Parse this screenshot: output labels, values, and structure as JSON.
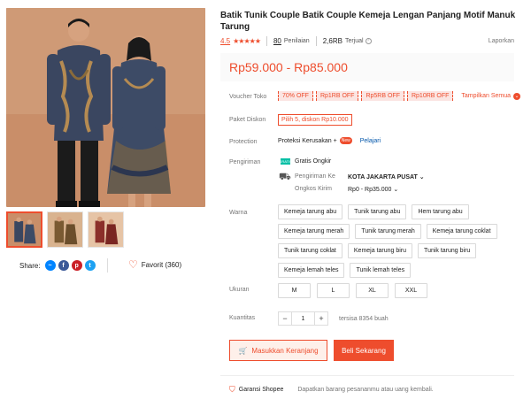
{
  "product": {
    "title": "Batik Tunik Couple Batik Couple Kemeja Lengan Panjang Motif Manuk Tarung",
    "rating": "4.5",
    "reviews_count": "80",
    "reviews_label": "Penilaian",
    "sold_count": "2,6RB",
    "sold_label": "Terjual",
    "report_label": "Laporkan",
    "price_range": "Rp59.000 - Rp85.000"
  },
  "voucher": {
    "label": "Voucher Toko",
    "items": [
      "70% OFF",
      "Rp1RB OFF",
      "Rp5RB OFF",
      "Rp10RB OFF"
    ],
    "show_all": "Tampilkan Semua"
  },
  "paket": {
    "label": "Paket Diskon",
    "value": "Pilih 5, diskon Rp10.000"
  },
  "protection": {
    "label": "Protection",
    "value": "Proteksi Kerusakan +",
    "badge": "New",
    "link": "Pelajari"
  },
  "shipping": {
    "label": "Pengiriman",
    "free_badge": "GRATIS",
    "free": "Gratis Ongkir",
    "to_label": "Pengiriman Ke",
    "to_value": "KOTA JAKARTA PUSAT",
    "cost_label": "Ongkos Kirim",
    "cost_value": "Rp0 - Rp35.000"
  },
  "color": {
    "label": "Warna",
    "options": [
      "Kemeja tarung abu",
      "Tunik tarung abu",
      "Hem tarung abu",
      "Kemeja tarung merah",
      "Tunik tarung merah",
      "Kemeja tarung coklat",
      "Tunik tarung coklat",
      "Kemeja tarung biru",
      "Tunik tarung biru",
      "Kemeja lemah teles",
      "Tunik lemah teles"
    ]
  },
  "size": {
    "label": "Ukuran",
    "options": [
      "M",
      "L",
      "XL",
      "XXL"
    ]
  },
  "quantity": {
    "label": "Kuantitas",
    "value": "1",
    "stock": "tersisa 8354 buah"
  },
  "actions": {
    "add_to_cart": "Masukkan Keranjang",
    "buy_now": "Beli Sekarang"
  },
  "guarantee": {
    "title": "Garansi Shopee",
    "desc": "Dapatkan barang pesananmu atau uang kembali."
  },
  "share": {
    "label": "Share:",
    "networks": [
      "messenger-icon",
      "facebook-icon",
      "pinterest-icon",
      "twitter-icon"
    ]
  },
  "favorite": {
    "label": "Favorit (360)"
  },
  "colors": {
    "accent": "#ee4d2d",
    "photo_bg": "#c88f6a",
    "batik_blue": "#3c4a63"
  }
}
